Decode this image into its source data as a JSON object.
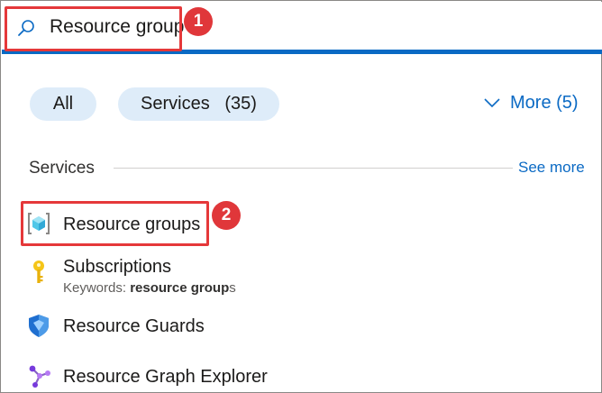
{
  "search": {
    "value": "Resource group",
    "icon": "search-icon"
  },
  "callouts": {
    "step1": "1",
    "step2": "2",
    "color": "#e0373a"
  },
  "filters": {
    "all_label": "All",
    "services_label": "Services",
    "services_count": "(35)",
    "more_label": "More (5)",
    "pill_bg": "#deecf9"
  },
  "section": {
    "title": "Services",
    "see_more": "See more"
  },
  "results": [
    {
      "label": "Resource groups",
      "icon": "resource-groups-icon"
    },
    {
      "label": "Subscriptions",
      "icon": "key-icon",
      "keywords_prefix": "Keywords: ",
      "keywords_match": "resource group",
      "keywords_suffix": "s"
    },
    {
      "label": "Resource Guards",
      "icon": "shield-icon"
    },
    {
      "label": "Resource Graph Explorer",
      "icon": "graph-explorer-icon"
    }
  ],
  "colors": {
    "accent": "#0a6ac4",
    "link": "#0b6ac4"
  }
}
